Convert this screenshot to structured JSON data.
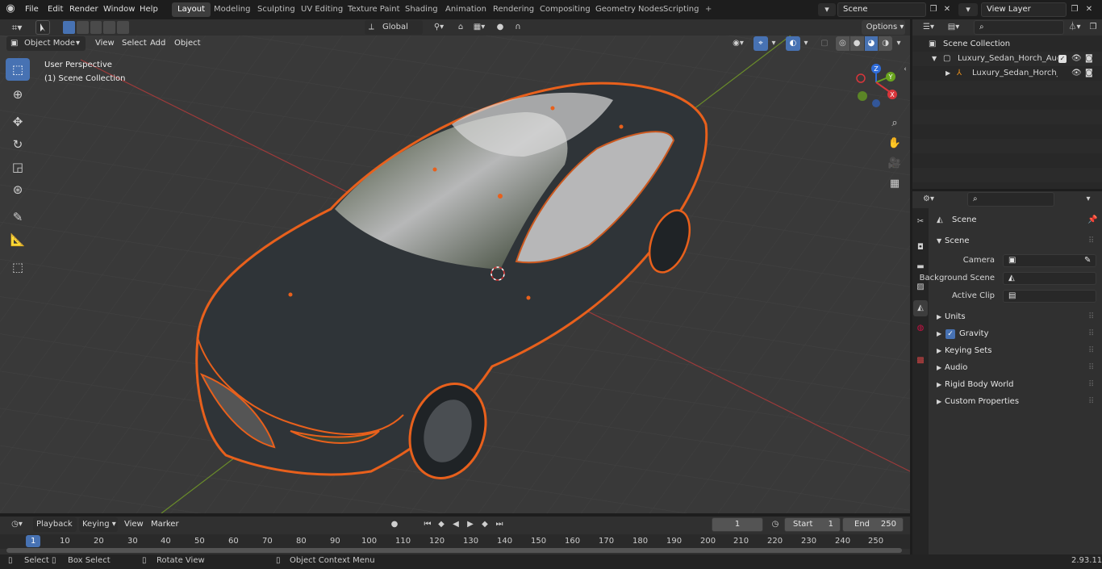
{
  "topbar": {
    "menus": [
      "File",
      "Edit",
      "Render",
      "Window",
      "Help"
    ],
    "workspaces": [
      "Layout",
      "Modeling",
      "Sculpting",
      "UV Editing",
      "Texture Paint",
      "Shading",
      "Animation",
      "Rendering",
      "Compositing",
      "Geometry Nodes",
      "Scripting"
    ],
    "active_workspace": "Layout",
    "add_workspace": "+",
    "scene": "Scene",
    "view_layer": "View Layer"
  },
  "viewport_header": {
    "mode": "Object Mode",
    "menus": [
      "View",
      "Select",
      "Add",
      "Object"
    ],
    "orientation": "Global",
    "options": "Options"
  },
  "viewport": {
    "perspective": "User Perspective",
    "collection": "(1) Scene Collection",
    "gizmo": {
      "x": "X",
      "y": "Y",
      "z": "Z"
    }
  },
  "outliner": {
    "root": "Scene Collection",
    "items": [
      {
        "label": "Luxury_Sedan_Horch_Audi_A"
      },
      {
        "label": "Luxury_Sedan_Horch_Au"
      }
    ]
  },
  "properties": {
    "context": "Scene",
    "panel": "Scene",
    "fields": {
      "camera": "Camera",
      "background_scene": "Background Scene",
      "active_clip": "Active Clip"
    },
    "sections": [
      "Units",
      "Gravity",
      "Keying Sets",
      "Audio",
      "Rigid Body World",
      "Custom Properties"
    ],
    "gravity_checked": true
  },
  "timeline": {
    "menus": [
      "Playback",
      "Keying",
      "View",
      "Marker"
    ],
    "current_frame": "1",
    "start_label": "Start",
    "start": "1",
    "end_label": "End",
    "end": "250",
    "ticks": [
      "1",
      "10",
      "20",
      "30",
      "40",
      "50",
      "60",
      "70",
      "80",
      "90",
      "100",
      "110",
      "120",
      "130",
      "140",
      "150",
      "160",
      "170",
      "180",
      "190",
      "200",
      "210",
      "220",
      "230",
      "240",
      "250"
    ]
  },
  "statusbar": {
    "select": "Select",
    "box_select": "Box Select",
    "rotate_view": "Rotate View",
    "context_menu": "Object Context Menu",
    "version": "2.93.11"
  },
  "colors": {
    "accent": "#4772b3",
    "selection_outline": "#e8601c",
    "grid": "#414141",
    "x_axis": "#9c3a3a",
    "y_axis": "#6a8c2a"
  }
}
